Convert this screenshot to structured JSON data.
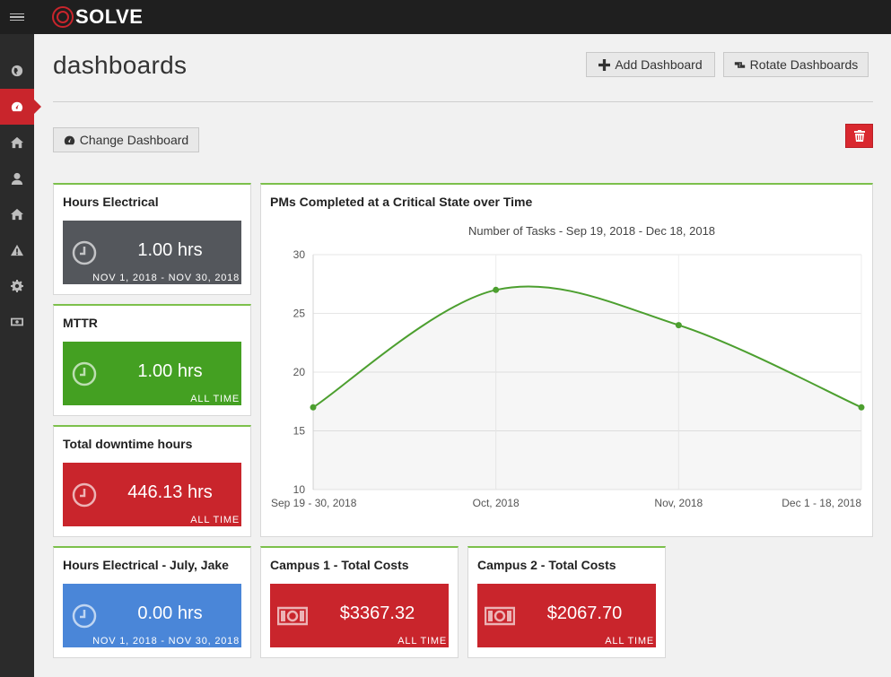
{
  "app": {
    "logo_text": "SOLVE"
  },
  "sidebar": {
    "items": [
      {
        "name": "globe-icon"
      },
      {
        "name": "dashboard-icon",
        "active": true
      },
      {
        "name": "home-icon"
      },
      {
        "name": "user-icon"
      },
      {
        "name": "home-icon"
      },
      {
        "name": "warning-icon"
      },
      {
        "name": "gear-icon"
      },
      {
        "name": "money-icon"
      }
    ]
  },
  "header": {
    "title": "dashboards",
    "add_label": "Add Dashboard",
    "rotate_label": "Rotate Dashboards",
    "change_label": "Change Dashboard"
  },
  "widgets": [
    {
      "title": "Hours Electrical",
      "value": "1.00 hrs",
      "range": "NOV 1, 2018 - NOV 30, 2018",
      "color": "#54575c",
      "icon": "clock-icon"
    },
    {
      "title": "MTTR",
      "value": "1.00 hrs",
      "range": "ALL TIME",
      "color": "#44a022",
      "icon": "clock-icon"
    },
    {
      "title": "Total downtime hours",
      "value": "446.13 hrs",
      "range": "ALL TIME",
      "color": "#c9252c",
      "icon": "clock-icon"
    },
    {
      "title": "Hours Electrical - July, Jake",
      "value": "0.00 hrs",
      "range": "NOV 1, 2018 - NOV 30, 2018",
      "color": "#4a86d8",
      "icon": "clock-icon"
    },
    {
      "title": "Campus 1 - Total Costs",
      "value": "$3367.32",
      "range": "ALL TIME",
      "color": "#c9252c",
      "icon": "money-icon"
    },
    {
      "title": "Campus 2 - Total Costs",
      "value": "$2067.70",
      "range": "ALL TIME",
      "color": "#c9252c",
      "icon": "money-icon"
    }
  ],
  "chart_data": {
    "type": "line",
    "title": "PMs Completed at a Critical State over Time",
    "subtitle": "Number of Tasks - Sep 19, 2018 - Dec 18, 2018",
    "categories": [
      "Sep 19 - 30, 2018",
      "Oct, 2018",
      "Nov, 2018",
      "Dec 1 - 18, 2018"
    ],
    "values": [
      17,
      27,
      24,
      17
    ],
    "ylim": [
      10,
      30
    ],
    "yticks": [
      10,
      15,
      20,
      25,
      30
    ],
    "line_color": "#4c9f2f",
    "grid": true,
    "legend": "none"
  }
}
